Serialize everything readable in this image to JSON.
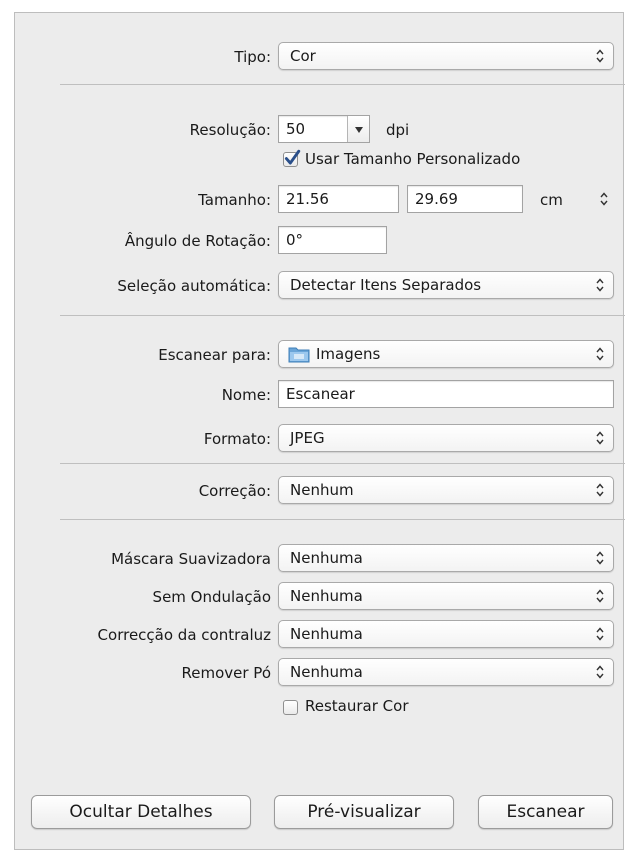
{
  "form": {
    "tipo": {
      "label": "Tipo:",
      "value": "Cor"
    },
    "resolucao": {
      "label": "Resolução:",
      "value": "50",
      "unit": "dpi"
    },
    "custom_size": {
      "label": "Usar Tamanho Personalizado",
      "checked": true
    },
    "tamanho": {
      "label": "Tamanho:",
      "width": "21.56",
      "height": "29.69",
      "unit": "cm"
    },
    "rotacao": {
      "label": "Ângulo de Rotação:",
      "value": "0°"
    },
    "selecao": {
      "label": "Seleção automática:",
      "value": "Detectar Itens Separados"
    },
    "escanear_para": {
      "label": "Escanear para:",
      "value": "Imagens",
      "icon": "folder-icon"
    },
    "nome": {
      "label": "Nome:",
      "value": "Escanear"
    },
    "formato": {
      "label": "Formato:",
      "value": "JPEG"
    },
    "correcao": {
      "label": "Correção:",
      "value": "Nenhum"
    },
    "mascara": {
      "label": "Máscara Suavizadora",
      "value": "Nenhuma"
    },
    "ondulacao": {
      "label": "Sem Ondulação",
      "value": "Nenhuma"
    },
    "contraluz": {
      "label": "Correcção da contraluz",
      "value": "Nenhuma"
    },
    "po": {
      "label": "Remover Pó",
      "value": "Nenhuma"
    },
    "restaurar_cor": {
      "label": "Restaurar Cor",
      "checked": false
    }
  },
  "buttons": {
    "hide_details": "Ocultar Detalhes",
    "preview": "Pré-visualizar",
    "scan": "Escanear"
  },
  "colors": {
    "panel_bg": "#ececec",
    "checkmark": "#2a4f8a",
    "folder_icon": "#6aa5d8"
  }
}
